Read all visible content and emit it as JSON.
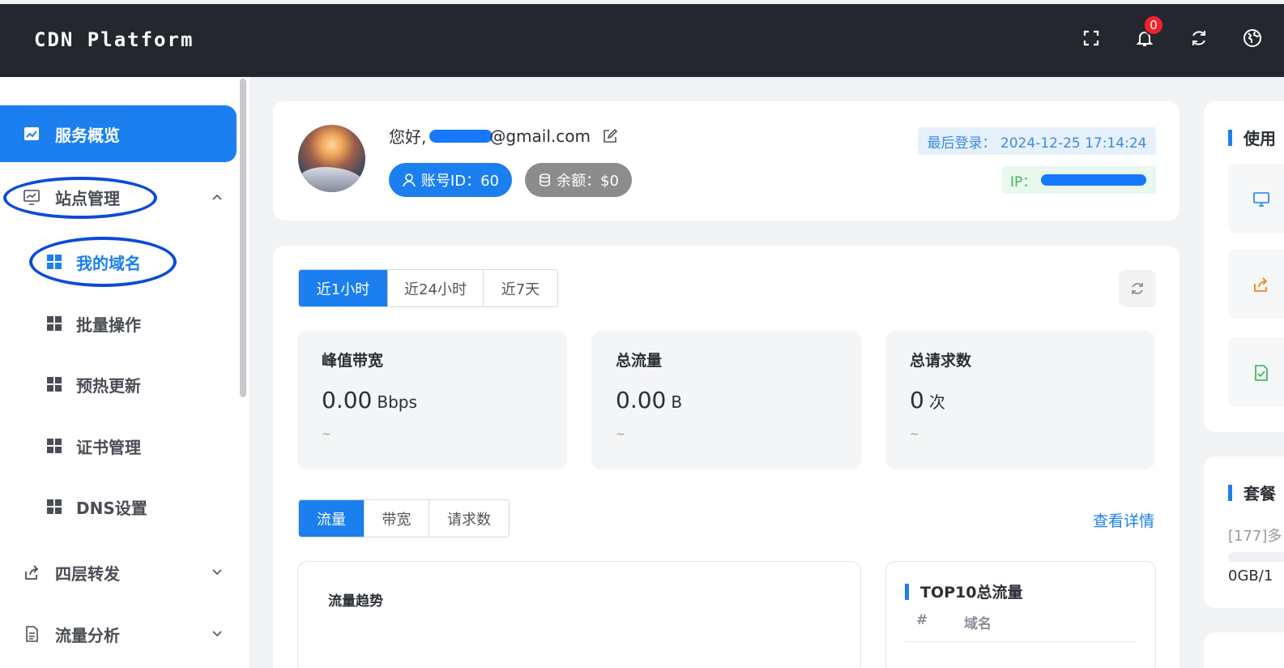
{
  "app": {
    "brand": "CDN Platform",
    "notification_count": "0"
  },
  "header_icons": [
    "fullscreen-icon",
    "bell-icon",
    "refresh-icon",
    "globe-icon"
  ],
  "sidebar": {
    "overview": "服务概览",
    "site_mgmt": "站点管理",
    "sub_items": [
      "我的域名",
      "批量操作",
      "预热更新",
      "证书管理",
      "DNS设置"
    ],
    "layer4": "四层转发",
    "traffic": "流量分析"
  },
  "profile": {
    "greeting_prefix": "您好,",
    "email_suffix": "@gmail.com",
    "account_id": "账号ID：60",
    "balance": "余额：$0",
    "last_login": "最后登录：  2024-12-25 17:14:24",
    "ip_label": "IP："
  },
  "time_tabs": [
    "近1小时",
    "近24小时",
    "近7天"
  ],
  "stats": [
    {
      "title": "峰值带宽",
      "value": "0.00",
      "unit": "Bbps",
      "sub": "~"
    },
    {
      "title": "总流量",
      "value": "0.00",
      "unit": "B",
      "sub": "~"
    },
    {
      "title": "总请求数",
      "value": "0",
      "unit": "次",
      "sub": "~"
    }
  ],
  "metric_tabs": [
    "流量",
    "带宽",
    "请求数"
  ],
  "view_details": "查看详情",
  "trend_title": "流量趋势",
  "top10": {
    "title": "TOP10总流量",
    "col_num": "#",
    "col_domain": "域名"
  },
  "right_panel": {
    "title1": "使用",
    "title2": "套餐",
    "package_text": "[177]多",
    "usage_text": "0GB/1"
  },
  "colors": {
    "primary": "#1b7ff0",
    "topbar": "#24272e",
    "badge": "#f5222d"
  }
}
